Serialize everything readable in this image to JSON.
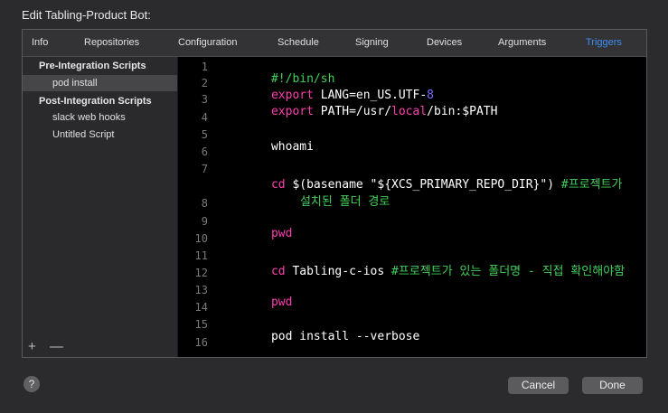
{
  "window": {
    "title": "Edit Tabling-Product Bot:"
  },
  "tabs": [
    {
      "label": "Info"
    },
    {
      "label": "Repositories"
    },
    {
      "label": "Configuration"
    },
    {
      "label": "Schedule"
    },
    {
      "label": "Signing"
    },
    {
      "label": "Devices"
    },
    {
      "label": "Arguments"
    },
    {
      "label": "Triggers"
    }
  ],
  "active_tab": "Triggers",
  "sidebar": {
    "pre_header": "Pre-Integration Scripts",
    "pre_items": [
      {
        "label": "pod install",
        "selected": true
      }
    ],
    "post_header": "Post-Integration Scripts",
    "post_items": [
      {
        "label": "slack web hooks"
      },
      {
        "label": "Untitled Script"
      }
    ],
    "add_icon": "plus-icon",
    "remove_icon": "minus-icon",
    "add_label": "+",
    "remove_label": "—"
  },
  "editor": {
    "line_numbers": [
      "1",
      "2",
      "3",
      "4",
      "5",
      "6",
      "7",
      "8",
      "9",
      "10",
      "11",
      "12",
      "13",
      "14",
      "15",
      "16"
    ],
    "lines": {
      "l1_comment": "#!/bin/sh",
      "l2_kw": "export",
      "l2_rest": " LANG=en_US.UTF-",
      "l2_num": "8",
      "l3_kw": "export",
      "l3_a": " PATH=/usr/",
      "l3_kw2": "local",
      "l3_b": "/bin:$PATH",
      "l5": "whoami",
      "l7_kw": "cd",
      "l7_rest": " $(basename \"${XCS_PRIMARY_REPO_DIR}\") ",
      "l7_comment": "#프로젝트가",
      "l7_cont": "설치된 폴더 경로",
      "l9_kw": "pwd",
      "l11_kw": "cd",
      "l11_rest": " Tabling-c-ios ",
      "l11_comment": "#프로젝트가 있는 폴더명 - 직접 확인해야함",
      "l13_kw": "pwd",
      "l15": "pod install --verbose"
    }
  },
  "footer": {
    "help_label": "?",
    "cancel_label": "Cancel",
    "done_label": "Done"
  },
  "colors": {
    "accent": "#3f8ef3",
    "keyword": "#ff3fb0",
    "comment": "#42d05a",
    "number": "#7a6cff"
  }
}
